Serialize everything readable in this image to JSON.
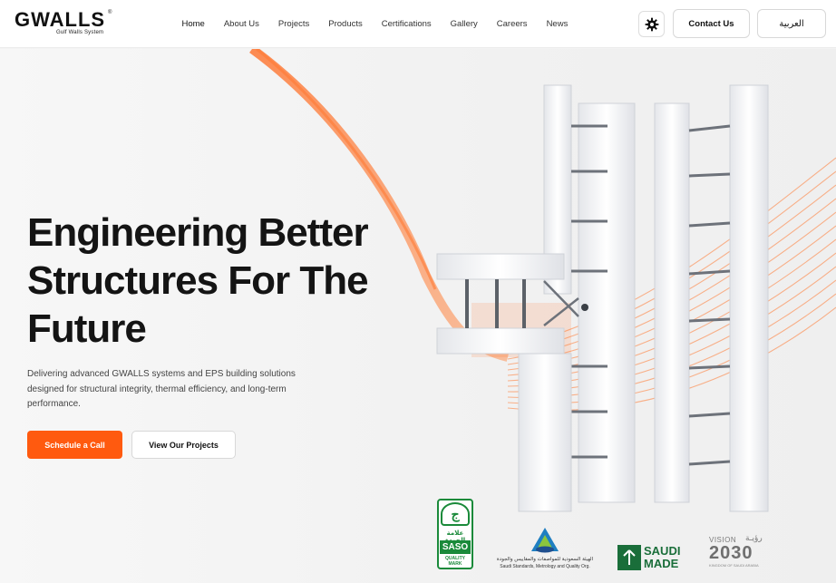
{
  "header": {
    "logo_text": "GWALLS",
    "logo_sub": "Gulf Walls System",
    "logo_reg": "®",
    "nav": [
      "Home",
      "About Us",
      "Projects",
      "Products",
      "Certifications",
      "Gallery",
      "Careers",
      "News"
    ],
    "active_nav": "Home",
    "theme_icon": "gear-icon",
    "contact_label": "Contact Us",
    "lang_label": "العربية"
  },
  "hero": {
    "headline": "Engineering Better Structures For The Future",
    "subtext": "Delivering advanced GWALLS systems and EPS building solutions designed for structural integrity, thermal efficiency, and long-term performance.",
    "primary_button": "Schedule a Call",
    "secondary_button": "View Our Projects"
  },
  "certifications": {
    "saso_quality": {
      "symbol": "ج",
      "arabic": "علامة الجودة",
      "name": "SASO",
      "caption": "QUALITY MARK"
    },
    "saso_org": {
      "name": "SASO",
      "arabic": "الهيئة السعودية للمواصفات والمقاييس والجودة",
      "english": "Saudi Standards, Metrology and Quality Org."
    },
    "saudi_made": {
      "line1": "SAUDI",
      "line2": "MADE"
    },
    "vision": {
      "label": "VISION",
      "arabic": "رؤيـة",
      "year": "2030",
      "caption": "KINGDOM OF SAUDI ARABIA"
    }
  },
  "colors": {
    "accent": "#ff5a0f",
    "green": "#1a8a3a"
  }
}
